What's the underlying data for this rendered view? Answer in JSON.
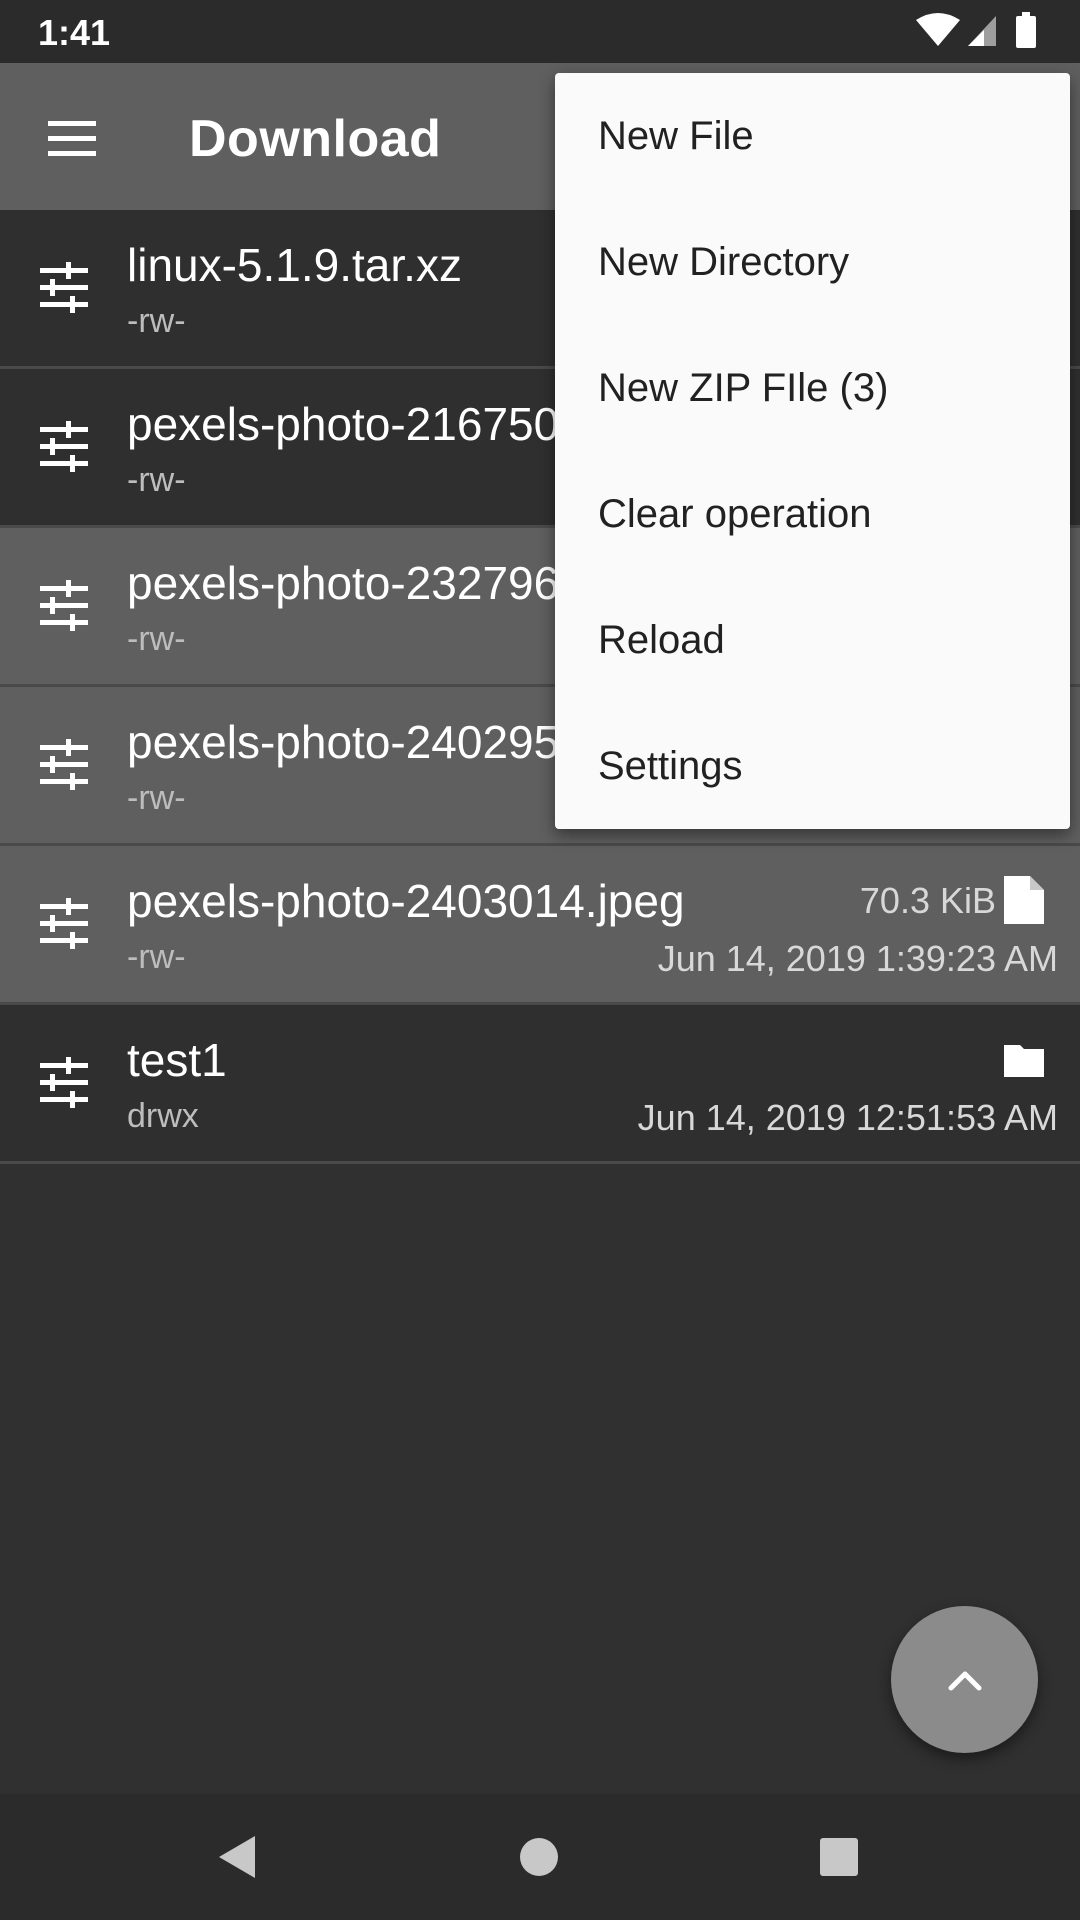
{
  "status_bar": {
    "time": "1:41",
    "icons": [
      "wifi-icon",
      "signal-icon",
      "battery-icon"
    ]
  },
  "app_bar": {
    "title": "Download",
    "menu_icon": "hamburger-menu-icon"
  },
  "files": [
    {
      "name": "linux-5.1.9.tar.xz",
      "perm": "-rw-",
      "size": "",
      "date": "",
      "type": "file",
      "selected": false
    },
    {
      "name": "pexels-photo-216750",
      "perm": "-rw-",
      "size": "",
      "date": "",
      "type": "file",
      "selected": false
    },
    {
      "name": "pexels-photo-232796",
      "perm": "-rw-",
      "size": "",
      "date": "",
      "type": "file",
      "selected": true
    },
    {
      "name": "pexels-photo-240295",
      "perm": "-rw-",
      "size": "",
      "date": "",
      "type": "file",
      "selected": true
    },
    {
      "name": "pexels-photo-2403014.jpeg",
      "perm": "-rw-",
      "size": "70.3 KiB",
      "date": "Jun 14, 2019 1:39:23 AM",
      "type": "file",
      "selected": true
    },
    {
      "name": "test1",
      "perm": "drwx",
      "size": "",
      "date": "Jun 14, 2019 12:51:53 AM",
      "type": "folder",
      "selected": false
    }
  ],
  "menu": {
    "items": [
      "New File",
      "New Directory",
      "New ZIP FIle (3)",
      "Clear operation",
      "Reload",
      "Settings"
    ]
  },
  "fab": {
    "icon": "chevron-up-icon"
  },
  "nav_bar": {
    "icons": [
      "back-icon",
      "home-icon",
      "recents-icon"
    ]
  },
  "colors": {
    "background": "#303030",
    "app_bar": "#5f5f5f",
    "selected_row": "#5f5f5f",
    "menu_background": "#fafafa",
    "fab": "#8b8b8b"
  }
}
